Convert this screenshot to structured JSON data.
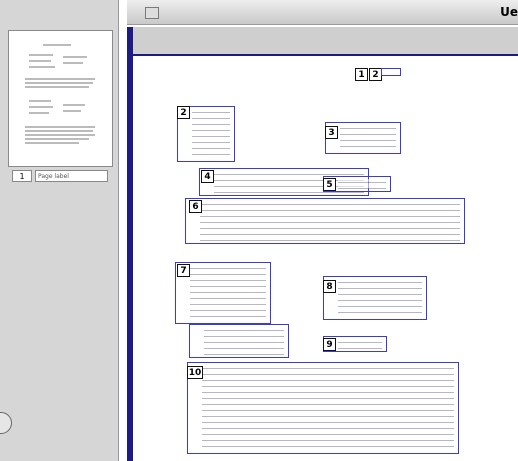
{
  "window": {
    "title_fragment": "Ue"
  },
  "sidebar": {
    "thumbnail_page_number": "1",
    "thumbnail_label": "Page label"
  },
  "document": {
    "region_numbers": [
      "1",
      "2",
      "3",
      "4",
      "5",
      "6",
      "7",
      "8",
      "9",
      "10"
    ],
    "top_marker_second": "2"
  }
}
